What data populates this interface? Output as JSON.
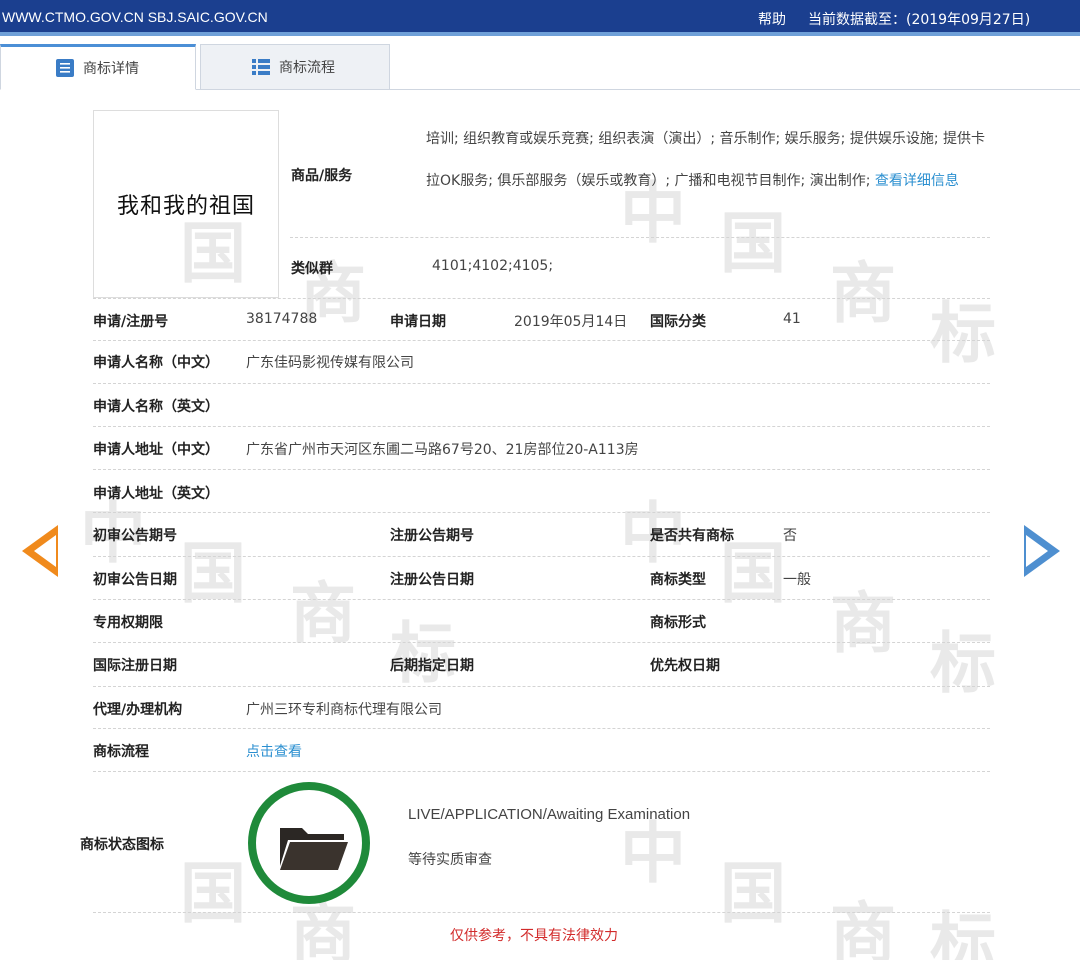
{
  "topbar": {
    "site": "WWW.CTMO.GOV.CN SBJ.SAIC.GOV.CN",
    "help": "帮助",
    "cutoff": "当前数据截至：(2019年09月27日)"
  },
  "tabs": [
    {
      "label": "商标详情",
      "icon": "document-lines-icon"
    },
    {
      "label": "商标流程",
      "icon": "list-icon"
    }
  ],
  "watermark_chars": [
    "中",
    "国",
    "商",
    "标"
  ],
  "mark": {
    "image_text": "我和我的祖国"
  },
  "goods": {
    "label": "商品/服务",
    "text": "培训; 组织教育或娱乐竞赛; 组织表演（演出）; 音乐制作; 娱乐服务; 提供娱乐设施; 提供卡拉OK服务; 俱乐部服务（娱乐或教育）; 广播和电视节目制作; 演出制作;",
    "more_link": "查看详细信息"
  },
  "similar_group": {
    "label": "类似群",
    "value": "4101;4102;4105;"
  },
  "fields": {
    "reg_no_label": "申请/注册号",
    "reg_no": "38174788",
    "app_date_label": "申请日期",
    "app_date": "2019年05月14日",
    "intl_class_label": "国际分类",
    "intl_class": "41",
    "applicant_cn_label": "申请人名称（中文）",
    "applicant_cn": "广东佳码影视传媒有限公司",
    "applicant_en_label": "申请人名称（英文）",
    "applicant_en": "",
    "address_cn_label": "申请人地址（中文）",
    "address_cn": "广东省广州市天河区东圃二马路67号20、21房部位20-A113房",
    "address_en_label": "申请人地址（英文）",
    "address_en": "",
    "prelim_pub_no_label": "初审公告期号",
    "prelim_pub_no": "",
    "reg_pub_no_label": "注册公告期号",
    "reg_pub_no": "",
    "shared_label": "是否共有商标",
    "shared": "否",
    "prelim_pub_date_label": "初审公告日期",
    "prelim_pub_date": "",
    "reg_pub_date_label": "注册公告日期",
    "reg_pub_date": "",
    "mark_type_label": "商标类型",
    "mark_type": "一般",
    "exclusive_period_label": "专用权期限",
    "exclusive_period": "",
    "mark_form_label": "商标形式",
    "mark_form": "",
    "intl_reg_date_label": "国际注册日期",
    "intl_reg_date": "",
    "later_designation_label": "后期指定日期",
    "later_designation": "",
    "priority_date_label": "优先权日期",
    "priority_date": "",
    "agent_label": "代理/办理机构",
    "agent": "广州三环专利商标代理有限公司",
    "process_label": "商标流程",
    "process_link": "点击查看"
  },
  "status": {
    "label": "商标状态图标",
    "icon": "folder-icon",
    "ring_color": "#1f8a3a",
    "en": "LIVE/APPLICATION/Awaiting Examination",
    "cn": "等待实质审查"
  },
  "disclaimer": "仅供参考，不具有法律效力",
  "colors": {
    "topbar": "#1b3f8f",
    "link": "#2b8fd0",
    "prev_arrow": "#f08a1c",
    "next_arrow": "#4e8fd0",
    "disclaimer": "#d22b2b"
  }
}
